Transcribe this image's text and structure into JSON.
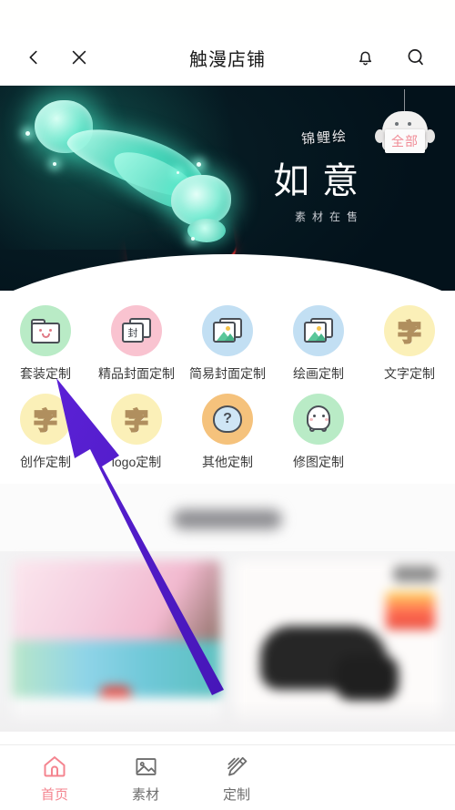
{
  "header": {
    "title": "触漫店铺",
    "back_icon": "chevron-left-icon",
    "close_icon": "close-icon",
    "bell_icon": "bell-icon",
    "search_icon": "search-icon"
  },
  "banner": {
    "brand": "锦鲤绘",
    "title": "如意",
    "subtitle": "素材在售",
    "lantern_badge": "全部",
    "background_color": "#051820",
    "accent_color": "#5fe6c4",
    "ribbon_color": "#d32b2b"
  },
  "categories": [
    {
      "label": "套装定制",
      "icon": "folder-smile-icon",
      "circle_color": "#b9ebc6"
    },
    {
      "label": "精品封面定制",
      "icon": "cover-cards-icon",
      "circle_color": "#f9c3d0",
      "glyph": "封"
    },
    {
      "label": "简易封面定制",
      "icon": "image-stack-icon",
      "circle_color": "#c2dff3"
    },
    {
      "label": "绘画定制",
      "icon": "image-stack-icon",
      "circle_color": "#c2dff3"
    },
    {
      "label": "文字定制",
      "icon": "text-zi-icon",
      "circle_color": "#fbf0b8",
      "glyph": "字"
    },
    {
      "label": "创作定制",
      "icon": "text-zi-icon",
      "circle_color": "#fbf0b8",
      "glyph": "字"
    },
    {
      "label": "logo定制",
      "icon": "text-zi-icon",
      "circle_color": "#fbf0b8",
      "glyph": "字"
    },
    {
      "label": "其他定制",
      "icon": "question-mark-icon",
      "circle_color": "#f5c27c",
      "glyph": "?"
    },
    {
      "label": "修图定制",
      "icon": "ghost-icon",
      "circle_color": "#b9ebc6"
    }
  ],
  "tabbar": {
    "items": [
      {
        "label": "首页",
        "icon": "home-icon",
        "active": true,
        "color": "#f4848f"
      },
      {
        "label": "素材",
        "icon": "image-icon",
        "active": false,
        "color": "#6d6d6d"
      },
      {
        "label": "定制",
        "icon": "pencil-icon",
        "active": false,
        "color": "#6d6d6d"
      }
    ]
  },
  "annotation": {
    "arrow_color": "#5b21d6",
    "points_to": "套装定制"
  }
}
